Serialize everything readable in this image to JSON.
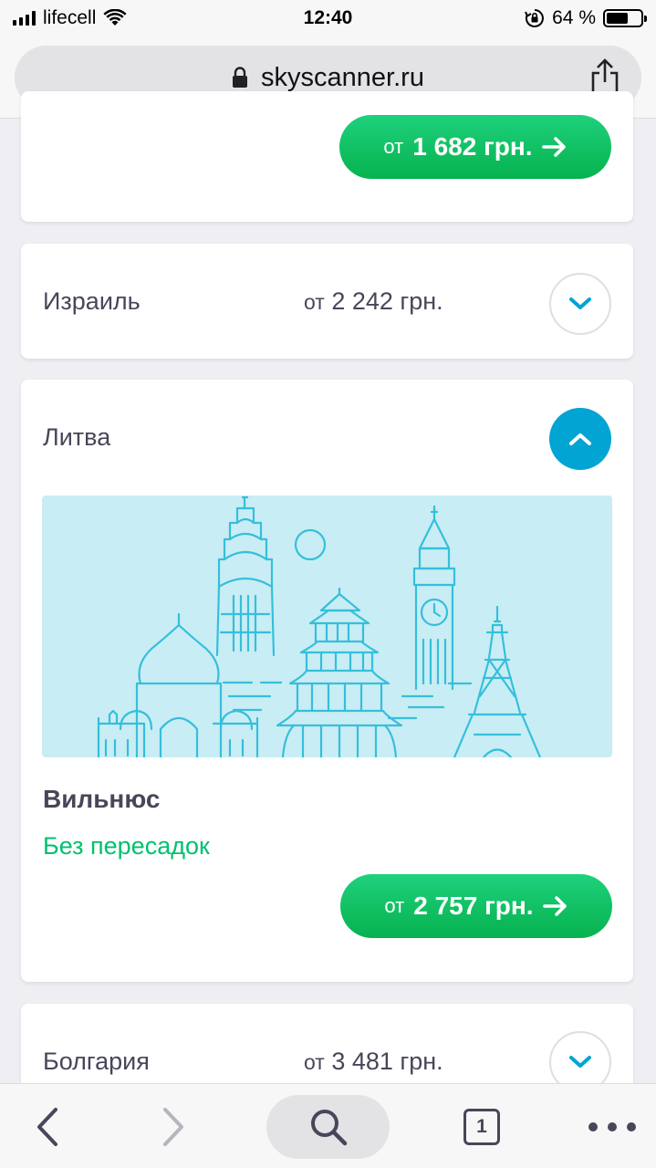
{
  "status_bar": {
    "carrier": "lifecell",
    "time": "12:40",
    "battery": "64 %",
    "battery_level": 0.64
  },
  "browser": {
    "url": "skyscanner.ru",
    "tab_count": "1"
  },
  "top_card": {
    "button_from": "от",
    "button_price": "1 682 грн."
  },
  "israel_card": {
    "country": "Израиль",
    "price_from": "от",
    "price": "2 242 грн."
  },
  "lithuania_card": {
    "country": "Литва",
    "city": "Вильнюс",
    "direct_label": "Без пересадок",
    "button_from": "от",
    "button_price": "2 757 грн."
  },
  "bulgaria_card": {
    "country": "Болгария",
    "price_from": "от",
    "price": "3 481 грн."
  },
  "colors": {
    "accent_green": "#07b24f",
    "accent_blue": "#02a4d4",
    "illustration_bg": "#c9edf4",
    "illustration_line": "#35bfdc"
  }
}
